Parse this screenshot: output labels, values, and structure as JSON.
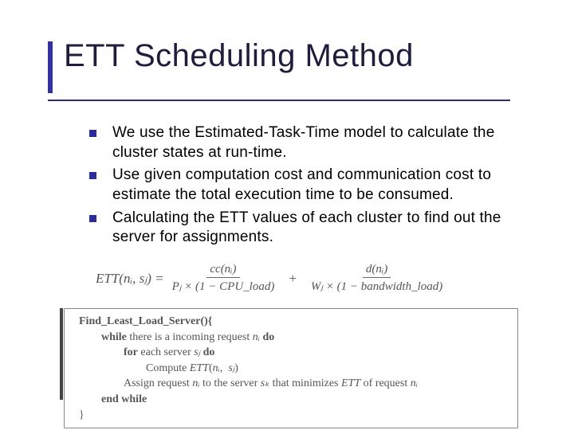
{
  "title": "ETT Scheduling Method",
  "bullets": [
    "We use the Estimated-Task-Time model to calculate the cluster states at run-time.",
    "Use given computation cost and communication cost to estimate the total execution time to be consumed.",
    "Calculating the ETT values of each cluster to find out the server for assignments."
  ],
  "formula": {
    "lhs": "ETT(nᵢ, sⱼ) =",
    "frac1_num": "cc(nᵢ)",
    "frac1_den": "Pⱼ × (1 − CPU_load)",
    "plus": "+",
    "frac2_num": "d(nᵢ)",
    "frac2_den": "Wⱼ × (1 − bandwidth_load)"
  },
  "algo": {
    "l1": "Find_Least_Load_Server(){",
    "l2": "while there is a incoming request nᵢ do",
    "l3": "for each server sⱼ do",
    "l4": "Compute ETT(nᵢ,  sⱼ)",
    "l5": "Assign request nᵢ to the server sₖ that minimizes ETT of request nᵢ",
    "l6": "end while",
    "l7": "}"
  }
}
